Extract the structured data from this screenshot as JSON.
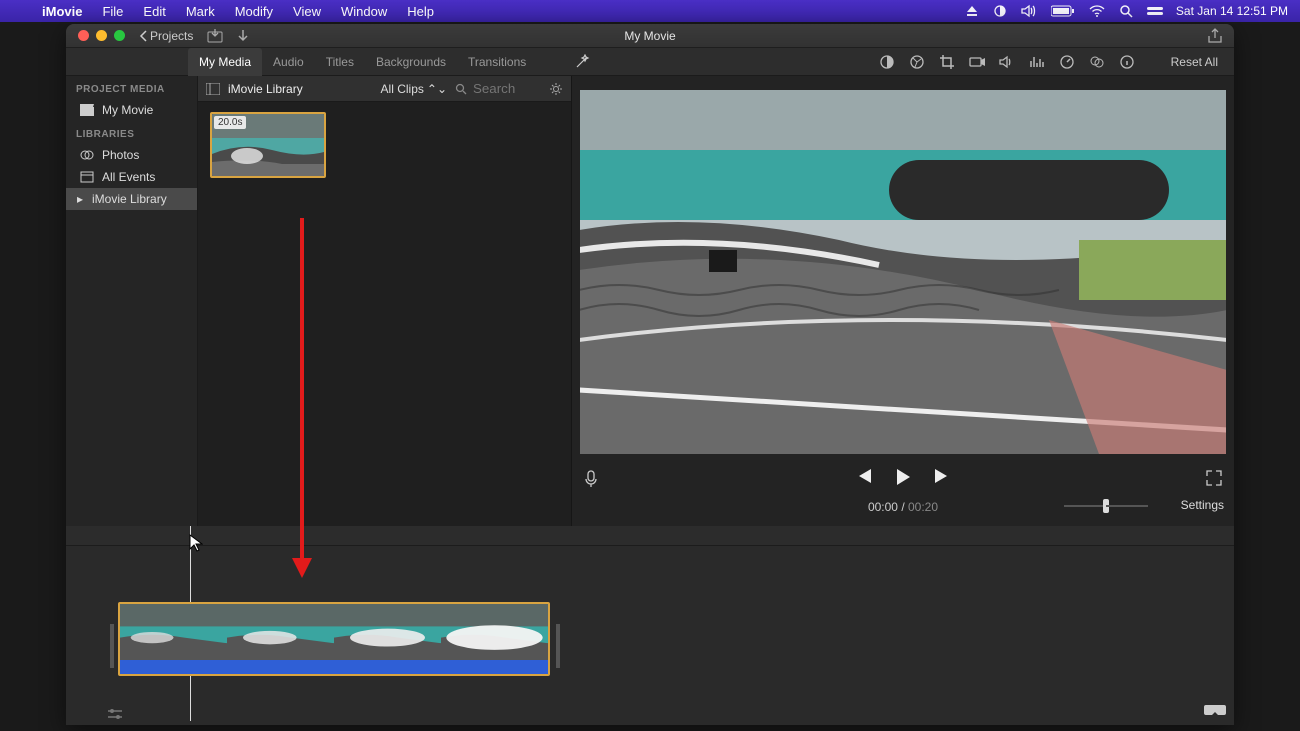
{
  "menubar": {
    "app": "iMovie",
    "menus": [
      "File",
      "Edit",
      "Mark",
      "Modify",
      "View",
      "Window",
      "Help"
    ],
    "clock": "Sat Jan 14  12:51 PM"
  },
  "window": {
    "back_label": "Projects",
    "title": "My Movie"
  },
  "tabs": {
    "items": [
      "My Media",
      "Audio",
      "Titles",
      "Backgrounds",
      "Transitions"
    ],
    "active": 0
  },
  "adjust": {
    "reset": "Reset All"
  },
  "sidebar": {
    "heading1": "PROJECT MEDIA",
    "project": "My Movie",
    "heading2": "LIBRARIES",
    "items": [
      "Photos",
      "All Events",
      "iMovie Library"
    ]
  },
  "media": {
    "library": "iMovie Library",
    "filter": "All Clips",
    "search_placeholder": "Search",
    "clip_duration": "20.0s"
  },
  "preview": {
    "current": "00:00",
    "duration": "00:20",
    "settings": "Settings"
  },
  "colors": {
    "selected": "#d9a441"
  }
}
